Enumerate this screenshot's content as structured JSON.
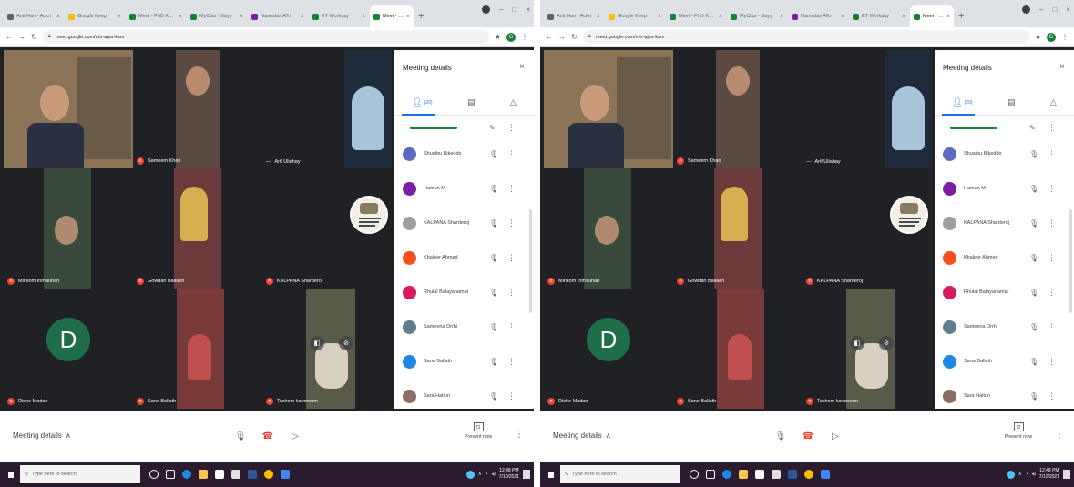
{
  "browser": {
    "tabs": [
      {
        "label": "Anti Hari - Ackri",
        "color": "#5f6368"
      },
      {
        "label": "Google Keep",
        "color": "#fbbc04"
      },
      {
        "label": "Meet - PhD Kore",
        "color": "#188038"
      },
      {
        "label": "MyClas - Sayy",
        "color": "#188038"
      },
      {
        "label": "Nanoslas ATo",
        "color": "#7b1fa2"
      },
      {
        "label": "ET Workday",
        "color": "#188038"
      },
      {
        "label": "Meet - dok",
        "color": "#188038",
        "active": true
      }
    ],
    "new_tab": "+",
    "url": "meet.google.com/mtr-ajsu-ksm",
    "profile_initial": "G",
    "window_buttons": [
      "–",
      "□",
      "×"
    ]
  },
  "meet": {
    "tiles": [
      {
        "name": "",
        "type": "video",
        "bg": "#8b7358"
      },
      {
        "name": "Sameem Khan",
        "type": "video",
        "bg": "#5a4a42"
      },
      {
        "name": "Arif Uliahay",
        "type": "video",
        "bg": "#1d2b3a"
      },
      {
        "name": "Mirikom Inmauriah",
        "type": "video",
        "bg": "#3a4a3a"
      },
      {
        "name": "Gowdan Ballaeh",
        "type": "video",
        "bg": "#6b3a3a"
      },
      {
        "name": "KALPANA Sharderoj",
        "type": "logo",
        "bg": "#202124"
      },
      {
        "name": "Dishe Madan",
        "type": "avatar",
        "initial": "D",
        "bg": "#202124"
      },
      {
        "name": "Sane Ballath",
        "type": "video",
        "bg": "#7a3a3a"
      },
      {
        "name": "Tashem kavonrum",
        "type": "video",
        "bg": "#5a5a48"
      }
    ],
    "side_panel": {
      "title": "Meeting details",
      "close": "×",
      "people_count": "(20)",
      "participants": [
        {
          "name": "Shuaibu Bikeddo",
          "color": "#5c6bc0"
        },
        {
          "name": "Hamun M",
          "color": "#7b1fa2"
        },
        {
          "name": "KALPANA Sharderoj",
          "color": "#9e9e9e"
        },
        {
          "name": "Khaleer Ahmed",
          "color": "#f4511e"
        },
        {
          "name": "Rhulal Balayanamar",
          "color": "#d81b60"
        },
        {
          "name": "Sameena Drrhi",
          "color": "#607d8b"
        },
        {
          "name": "Sana Ballath",
          "color": "#1e88e5"
        },
        {
          "name": "Sara Haitun",
          "color": "#8d6e63"
        }
      ]
    },
    "bottom": {
      "details_label": "Meeting details",
      "present_label": "Present now"
    }
  },
  "taskbar": {
    "search_placeholder": "Type here to search",
    "time": "12:48 PM",
    "date": "7/10/2021"
  }
}
